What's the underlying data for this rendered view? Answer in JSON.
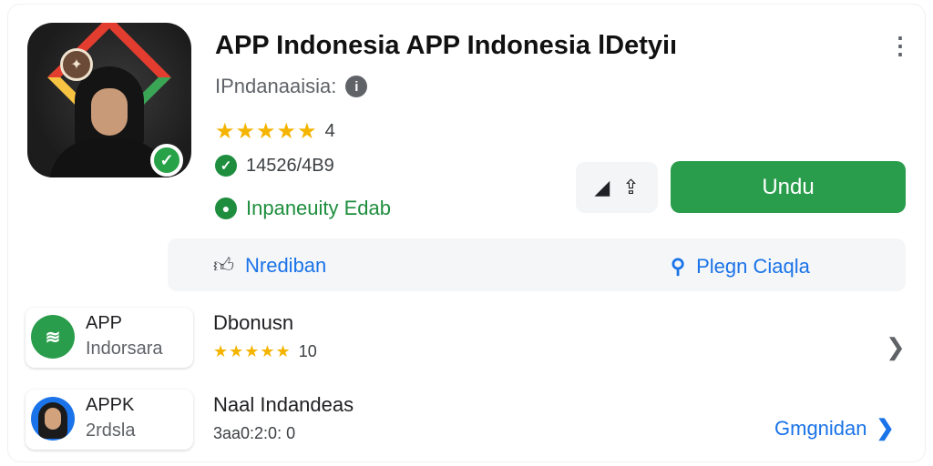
{
  "app": {
    "title": "APP Indonesia APP Indonesia lDetyiı",
    "developer": "IPndanaaisia:",
    "rating_stars": "★★★★★",
    "rating_value": "4",
    "downloads": "14526/4B9",
    "status": "Inpaneuity Edab"
  },
  "buttons": {
    "share_label": "⨚",
    "install_label": "Undu"
  },
  "actions": {
    "left_label": "Nrediban",
    "right_label": "Plegn Ciaqla"
  },
  "related": [
    {
      "chip_name": "APP",
      "chip_sub": "Indorsara",
      "title": "Dbonusn",
      "stars": "★★★★★",
      "meta": "10"
    },
    {
      "chip_name": "APPK",
      "chip_sub": "2rdsla",
      "title": "Naal Indandeas",
      "meta": "3aa0:2:0: 0",
      "link_label": "Gmgnidan"
    }
  ],
  "icons": {
    "menu": "more-vert-icon",
    "info": "info-icon",
    "verified": "check-circle-icon",
    "share": "share-icon",
    "thumbs": "thumb-icon",
    "search": "search-icon",
    "chevron": "chevron-right-icon"
  },
  "colors": {
    "install_green": "#2a9d4c",
    "accent_blue": "#1a73e8",
    "star_yellow": "#f4b400"
  }
}
